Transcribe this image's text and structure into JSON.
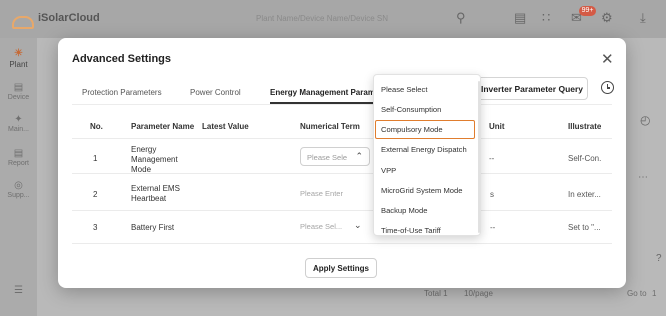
{
  "app": {
    "brand": "iSolarCloud",
    "search_placeholder": "Plant Name/Device Name/Device SN",
    "message_badge": "99+"
  },
  "sidebar": {
    "items": [
      {
        "label": "Plant",
        "icon": "plant-icon"
      },
      {
        "label": "Device",
        "icon": "device-icon"
      },
      {
        "label": "Main...",
        "icon": "maintenance-icon"
      },
      {
        "label": "Report",
        "icon": "report-icon"
      },
      {
        "label": "Supp...",
        "icon": "support-icon"
      }
    ]
  },
  "footer": {
    "total_label": "Total 1",
    "per_page": "10/page",
    "goto_label": "Go to",
    "goto_value": "1"
  },
  "modal": {
    "title": "Advanced Settings",
    "tabs": [
      {
        "label": "Protection Parameters"
      },
      {
        "label": "Power Control"
      },
      {
        "label": "Energy Management Param"
      }
    ],
    "query_button": "Inverter Parameter Query",
    "columns": [
      "No.",
      "Parameter Name",
      "Latest Value",
      "Numerical Term",
      "Unit",
      "Illustrate"
    ],
    "rows": [
      {
        "no": "1",
        "name": "Energy Management Mode",
        "latest": "",
        "term": "Please Sele",
        "unit": "--",
        "illustrate": "Self-Con."
      },
      {
        "no": "2",
        "name": "External EMS Heartbeat",
        "latest": "",
        "term": "Please Enter",
        "unit": "s",
        "illustrate": "In exter..."
      },
      {
        "no": "3",
        "name": "Battery First",
        "latest": "",
        "term": "Please Sel...",
        "unit": "--",
        "illustrate": "Set to \"..."
      }
    ],
    "apply_button": "Apply Settings"
  },
  "dropdown": {
    "options": [
      "Please Select",
      "Self-Consumption",
      "Compulsory Mode",
      "External Energy Dispatch",
      "VPP",
      "MicroGrid System Mode",
      "Backup Mode",
      "Time-of-Use Tariff"
    ],
    "highlighted": "Compulsory Mode",
    "highlight_color": "#e07d2e"
  }
}
